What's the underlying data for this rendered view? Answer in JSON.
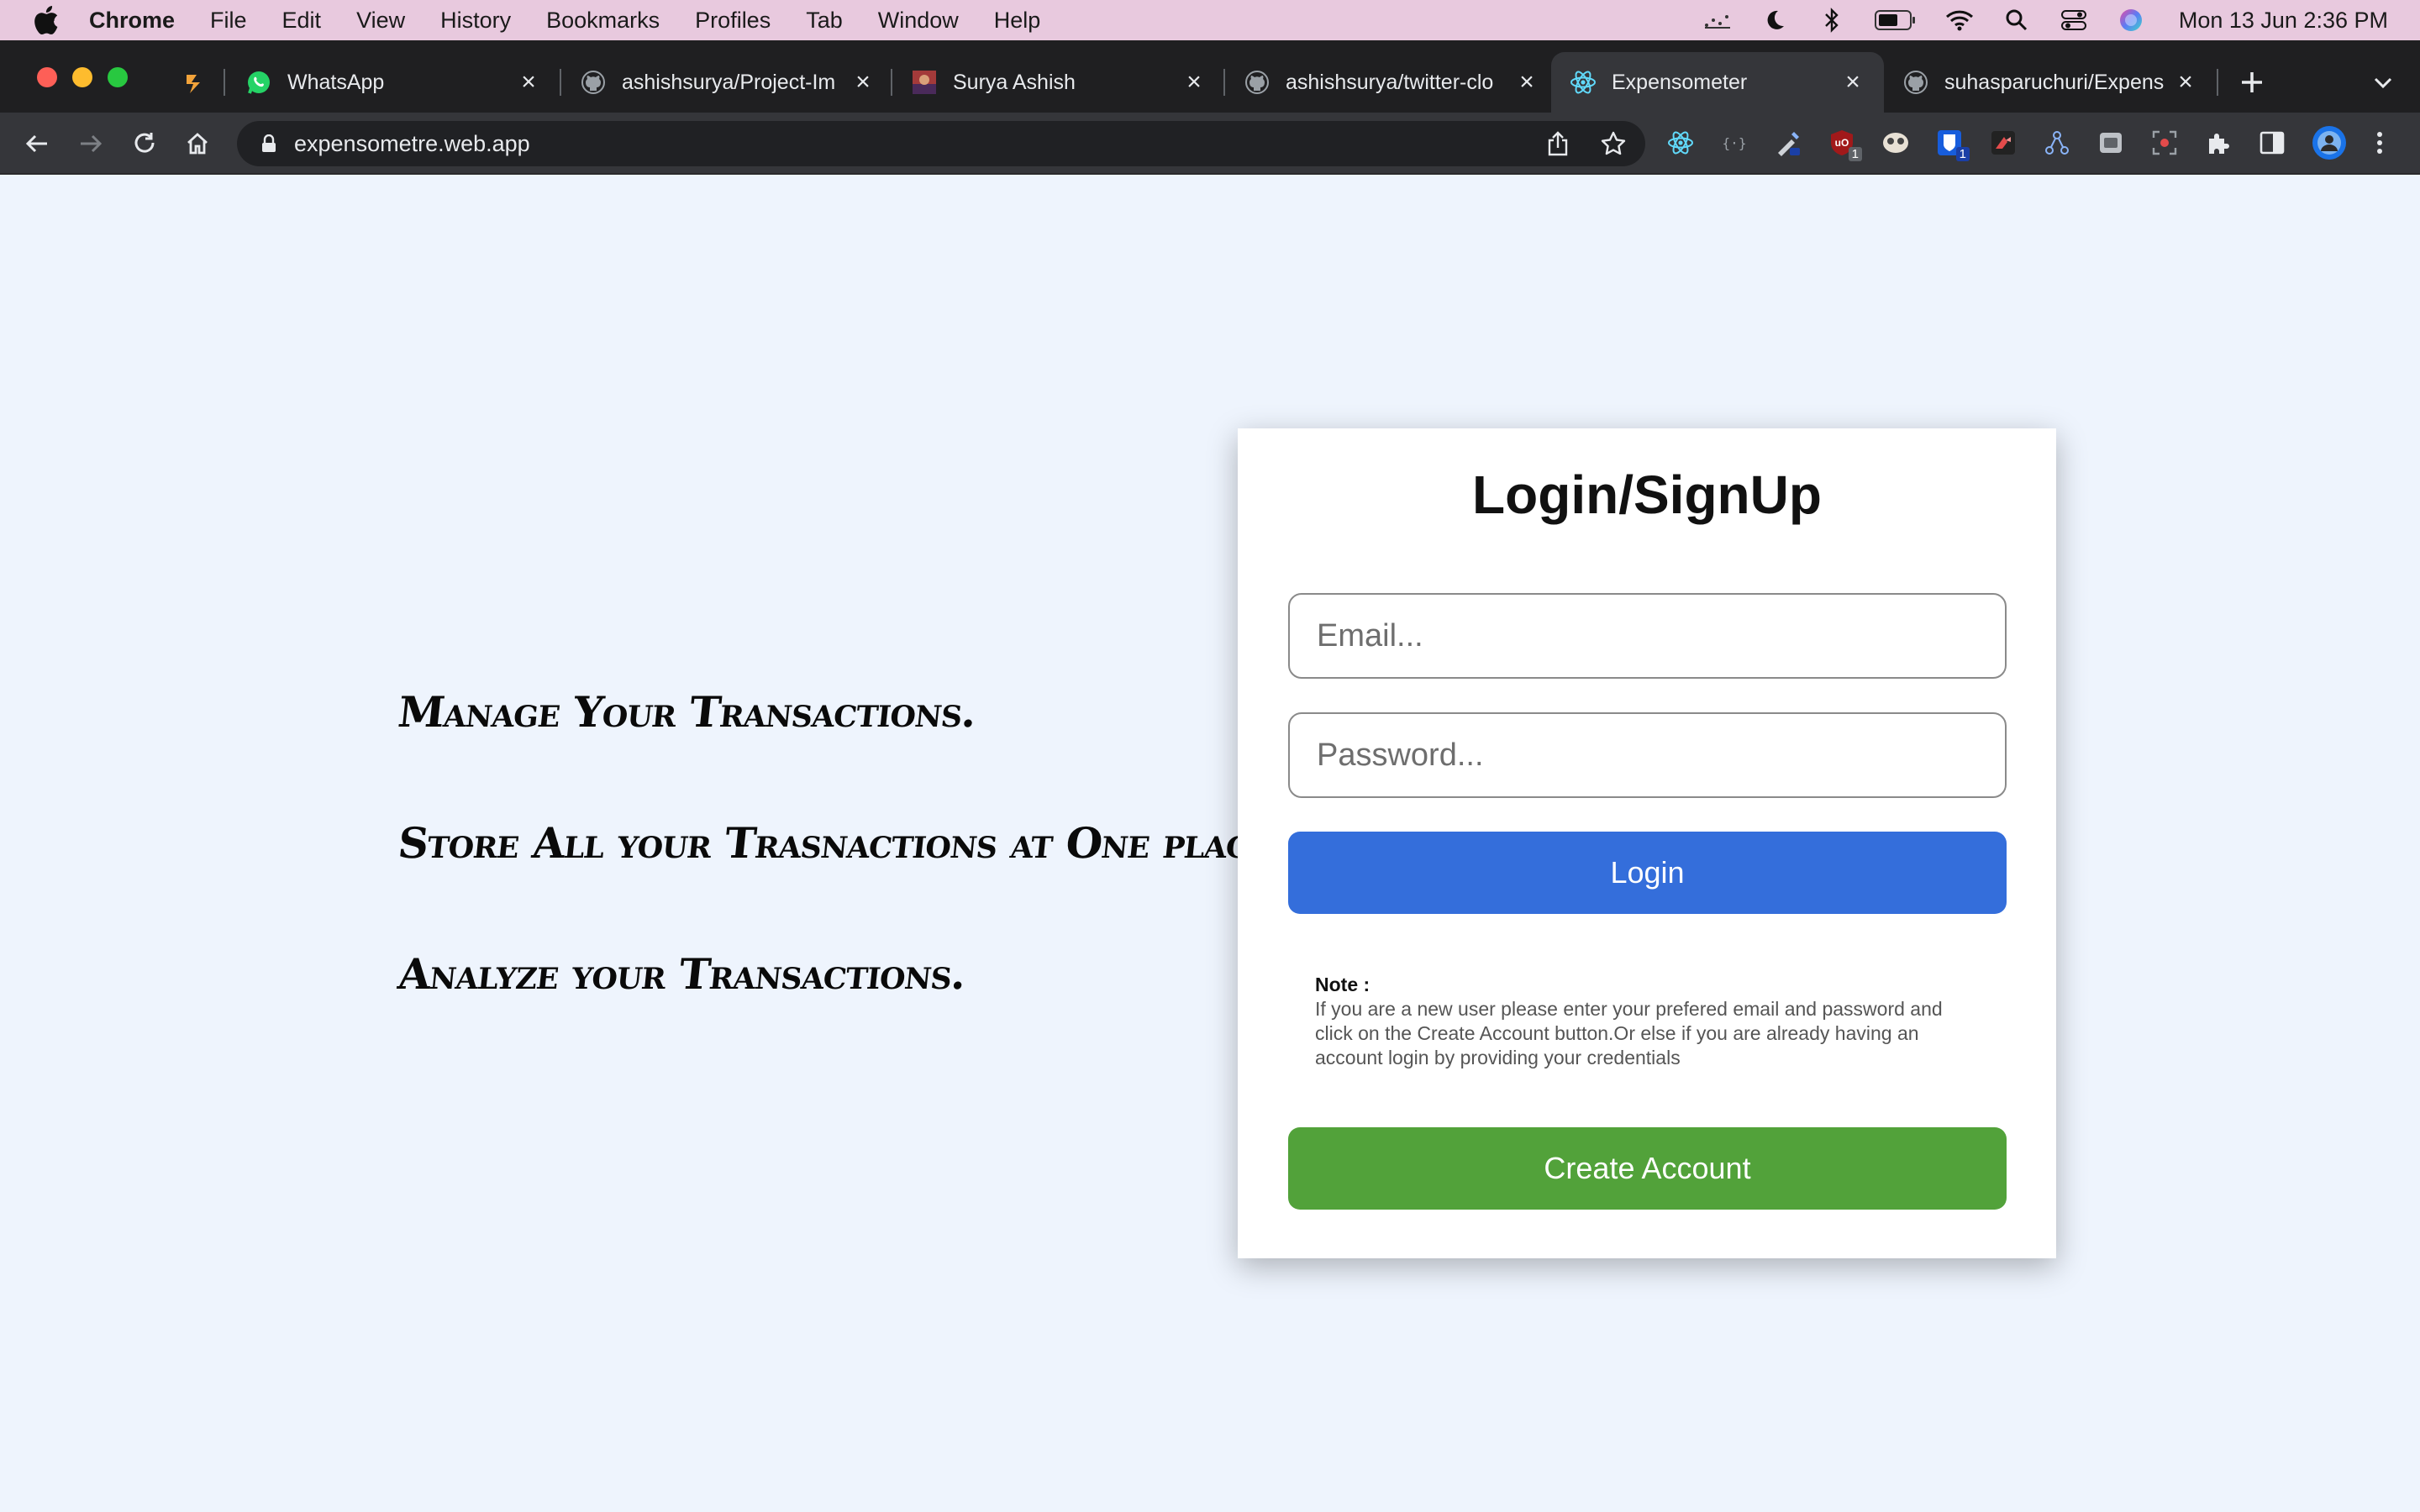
{
  "menubar": {
    "app_name": "Chrome",
    "items": [
      "File",
      "Edit",
      "View",
      "History",
      "Bookmarks",
      "Profiles",
      "Tab",
      "Window",
      "Help"
    ],
    "clock": "Mon 13 Jun  2:36 PM"
  },
  "tabs": [
    {
      "title": "WhatsApp",
      "icon": "whatsapp-icon",
      "active": false
    },
    {
      "title": "ashishsurya/Project-Im",
      "icon": "github-icon",
      "active": false
    },
    {
      "title": "Surya Ashish",
      "icon": "profile-image-icon",
      "active": false
    },
    {
      "title": "ashishsurya/twitter-clo",
      "icon": "github-icon",
      "active": false
    },
    {
      "title": "Expensometer",
      "icon": "react-icon",
      "active": true
    },
    {
      "title": "suhasparuchuri/Expens",
      "icon": "github-icon",
      "active": false
    }
  ],
  "toolbar": {
    "url": "expensometre.web.app",
    "extensions": [
      {
        "icon": "react-devtools-icon"
      },
      {
        "icon": "json-formatter-icon"
      },
      {
        "icon": "color-picker-icon"
      },
      {
        "icon": "ublock-origin-icon",
        "badge": "1"
      },
      {
        "icon": "mask-icon"
      },
      {
        "icon": "bitwarden-icon",
        "badge": "1"
      },
      {
        "icon": "wappalyzer-icon"
      },
      {
        "icon": "graph-icon"
      },
      {
        "icon": "window-icon"
      },
      {
        "icon": "screenshot-icon"
      },
      {
        "icon": "puzzle-extensions-icon"
      },
      {
        "icon": "side-panel-icon"
      },
      {
        "icon": "profile-avatar-icon"
      },
      {
        "icon": "more-menu-icon"
      }
    ]
  },
  "page": {
    "taglines": [
      "Manage Your Transactions.",
      "Store All your Trasnactions at One place.",
      "Analyze your Transactions."
    ],
    "card": {
      "title": "Login/SignUp",
      "email_placeholder": "Email...",
      "password_placeholder": "Password...",
      "login_label": "Login",
      "note_label": "Note :",
      "note_text": "If you are a new user please enter your prefered email and password and click on the Create Account button.Or else if you are already having an account login by providing your credentials",
      "create_label": "Create Account"
    }
  },
  "colors": {
    "page_bg": "#eef4fd",
    "login_button": "#346edb",
    "create_button": "#52a23a",
    "menubar_bg": "#e8c9de",
    "tabstrip_bg": "#1f1f21"
  }
}
